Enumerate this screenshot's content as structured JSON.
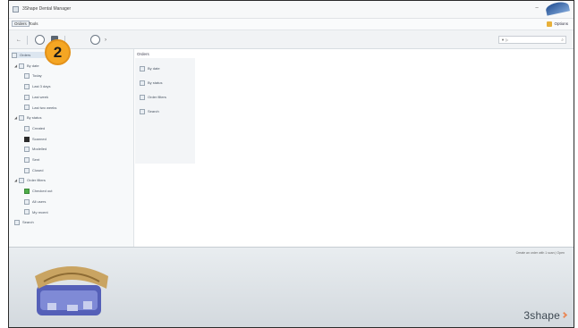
{
  "window": {
    "title": "3Shape Dental Manager"
  },
  "menu": {
    "items": [
      "Orders",
      "Tools"
    ],
    "user_label": "Options"
  },
  "toolbar": {
    "search_placeholder": "▼ ▷"
  },
  "badge": {
    "number": "2"
  },
  "tree": {
    "items": [
      {
        "label": "Orders",
        "level": 0,
        "root": true
      },
      {
        "label": "By date",
        "level": 1,
        "arrow": "◢"
      },
      {
        "label": "Today",
        "level": 2
      },
      {
        "label": "Last 3 days",
        "level": 2
      },
      {
        "label": "Last week",
        "level": 2
      },
      {
        "label": "Last two weeks",
        "level": 2
      },
      {
        "label": "By status",
        "level": 1,
        "arrow": "◢"
      },
      {
        "label": "Created",
        "level": 2
      },
      {
        "label": "Scanned",
        "level": 2,
        "dark": true
      },
      {
        "label": "Modelled",
        "level": 2
      },
      {
        "label": "Sent",
        "level": 2
      },
      {
        "label": "Closed",
        "level": 2
      },
      {
        "label": "Order filters",
        "level": 1,
        "arrow": "◢"
      },
      {
        "label": "Checked out",
        "level": 2,
        "green": true
      },
      {
        "label": "All users",
        "level": 2
      },
      {
        "label": "My recent",
        "level": 2
      },
      {
        "label": "Search",
        "level": 1
      }
    ]
  },
  "content": {
    "header": "Orders",
    "actions": [
      "By date",
      "By status",
      "Order filters",
      "Search"
    ]
  },
  "bottom": {
    "status": "Create an order with 1 scan | Open",
    "brand": "3shape"
  }
}
